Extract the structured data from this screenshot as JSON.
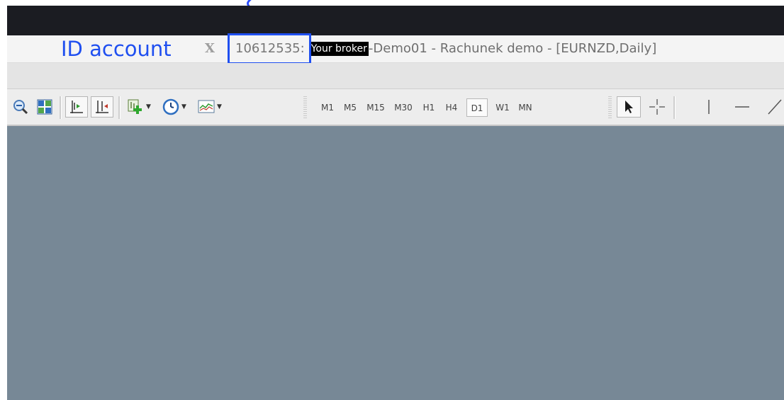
{
  "annotation": {
    "label": "ID account"
  },
  "window": {
    "close_glyph": "X",
    "account_id": "10612535:",
    "broker": "Your broker",
    "title_rest": "-Demo01 - Rachunek demo - [EURNZD,Daily]"
  },
  "toolbar": {
    "icons": [
      "zoom-out-icon",
      "tile-windows-icon",
      "chart-shift-icon",
      "auto-scroll-icon",
      "new-order-icon",
      "history-clock-icon",
      "indicators-icon",
      "cursor-icon",
      "crosshair-icon",
      "vertical-line-icon",
      "horizontal-line-icon",
      "trendline-icon"
    ],
    "timeframes": [
      "M1",
      "M5",
      "M15",
      "M30",
      "H1",
      "H4",
      "D1",
      "W1",
      "MN"
    ],
    "active_timeframe": "D1"
  },
  "colors": {
    "annotation_blue": "#1f4ff0",
    "chart_background": "#778896",
    "top_bar": "#1b1c22"
  }
}
